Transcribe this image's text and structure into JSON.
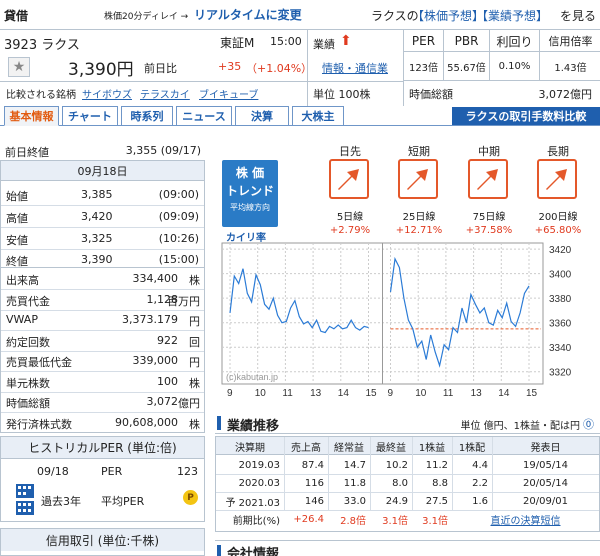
{
  "header": {
    "category": "貸借",
    "delay_note": "株価20分ディレイ →",
    "realtime_link": "リアルタイムに変更",
    "company_prefix": "ラクスの",
    "forecast_link1": "【株価予想】",
    "forecast_link2": "【業績予想】",
    "see_label": "を見る"
  },
  "stock": {
    "code_name": "3923 ラクス",
    "market": "東証M",
    "time": "15:00",
    "price": "3,390円",
    "prev_label": "前日比",
    "change": "+35",
    "change_pct": "（+1.04%）",
    "compare_label": "比較される銘柄",
    "compare_1": "サイボウズ",
    "compare_2": "テラスカイ",
    "compare_3": "ブイキューブ",
    "industry_label": "業績",
    "industry_link": "情報・通信業",
    "unit_label": "単位 100株"
  },
  "indicators": {
    "headers": [
      "PER",
      "PBR",
      "利回り",
      "信用倍率"
    ],
    "values": [
      "123倍",
      "55.67倍",
      "0.10%",
      "1.43倍"
    ],
    "market_cap_label": "時価総額",
    "market_cap_value": "3,072億円"
  },
  "tabs": [
    "基本情報",
    "チャート",
    "時系列",
    "ニュース",
    "決算",
    "大株主"
  ],
  "commission_banner": "ラクスの取引手数料比較",
  "prev_close": {
    "label": "前日終値",
    "value": "3,355 (09/17)"
  },
  "day": {
    "date": "09月18日",
    "rows": [
      {
        "label": "始値",
        "value": "3,385",
        "time": "(09:00)"
      },
      {
        "label": "高値",
        "value": "3,420",
        "time": "(09:09)"
      },
      {
        "label": "安値",
        "value": "3,325",
        "time": "(10:26)"
      },
      {
        "label": "終値",
        "value": "3,390",
        "time": "(15:00)"
      }
    ]
  },
  "stats": [
    {
      "label": "出来高",
      "value": "334,400",
      "unit": "株"
    },
    {
      "label": "売買代金",
      "value": "1,128",
      "unit": "百万円"
    },
    {
      "label": "VWAP",
      "value": "3,373.179",
      "unit": "円"
    },
    {
      "label": "約定回数",
      "value": "922",
      "unit": "回"
    },
    {
      "label": "売買最低代金",
      "value": "339,000",
      "unit": "円"
    },
    {
      "label": "単元株数",
      "value": "100",
      "unit": "株"
    },
    {
      "label": "時価総額",
      "value": "3,072",
      "unit": "億円"
    },
    {
      "label": "発行済株式数",
      "value": "90,608,000",
      "unit": "株"
    }
  ],
  "hist_per": {
    "title": "ヒストリカルPER (単位:倍)",
    "date": "09/18",
    "per_label": "PER",
    "per_value": "123",
    "period": "過去3年",
    "avg_label": "平均PER",
    "p_badge": "P"
  },
  "margin": {
    "title": "信用取引 (単位:千株)"
  },
  "trend": {
    "badge_line1": "株 価",
    "badge_line2": "トレンド",
    "badge_line3": "平均線方向",
    "kairi_label": "カイリ率",
    "items": [
      {
        "period": "日先",
        "ma": "5日線",
        "pct": "+2.79%"
      },
      {
        "period": "短期",
        "ma": "25日線",
        "pct": "+12.71%"
      },
      {
        "period": "中期",
        "ma": "75日線",
        "pct": "+37.58%"
      },
      {
        "period": "長期",
        "ma": "200日線",
        "pct": "+65.80%"
      }
    ]
  },
  "chart_data": {
    "type": "line",
    "title": "",
    "watermark": "(c)kabutan.jp",
    "x_ticks": [
      "9",
      "10",
      "11",
      "13",
      "14",
      "15",
      "9",
      "10",
      "11",
      "13",
      "14",
      "15"
    ],
    "y_ticks": [
      "3420",
      "3400",
      "3380",
      "3360",
      "3340",
      "3320"
    ],
    "ylim": [
      3310,
      3425
    ],
    "reference_line": 3355,
    "series": [
      {
        "name": "",
        "day": "09/17",
        "values": [
          3368,
          3398,
          3392,
          3404,
          3384,
          3377,
          3399,
          3391,
          3375,
          3371,
          3380,
          3366,
          3360,
          3361,
          3372,
          3378,
          3365,
          3359,
          3361,
          3356,
          3362,
          3353,
          3352,
          3357,
          3355,
          3358,
          3355,
          3356,
          3362,
          3356,
          3354,
          3357,
          3356
        ]
      },
      {
        "name": "",
        "day": "09/18",
        "values": [
          3385,
          3412,
          3405,
          3380,
          3362,
          3355,
          3340,
          3345,
          3330,
          3350,
          3336,
          3325,
          3342,
          3338,
          3356,
          3352,
          3372,
          3360,
          3383,
          3375,
          3368,
          3372,
          3360,
          3358,
          3370,
          3364,
          3376,
          3361,
          3357,
          3368,
          3384,
          3390
        ]
      }
    ]
  },
  "earnings": {
    "title": "業績推移",
    "unit": "単位 億円、1株益・配は円",
    "headers": [
      "決算期",
      "売上高",
      "経常益",
      "最終益",
      "1株益",
      "1株配",
      "発表日"
    ],
    "rows": [
      [
        "2019.03",
        "87.4",
        "14.7",
        "10.2",
        "11.2",
        "4.4",
        "19/05/14"
      ],
      [
        "2020.03",
        "116",
        "11.8",
        "8.0",
        "8.8",
        "2.2",
        "20/05/14"
      ],
      [
        "予 2021.03",
        "146",
        "33.0",
        "24.9",
        "27.5",
        "1.6",
        "20/09/01"
      ]
    ],
    "yoy": [
      "前期比(%)",
      "+26.4",
      "2.8倍",
      "3.1倍",
      "3.1倍",
      "直近の決算短信"
    ]
  },
  "company": {
    "title": "会社情報"
  },
  "colors": {
    "accent_blue": "#1f5fae",
    "accent_red": "#e03a1f",
    "tab_active": "#e25c12",
    "banner": "#1f5fae",
    "trend_badge": "#2a7bc6",
    "chart_line": "#2b7bd6",
    "ref_line": "#e85a2a"
  }
}
